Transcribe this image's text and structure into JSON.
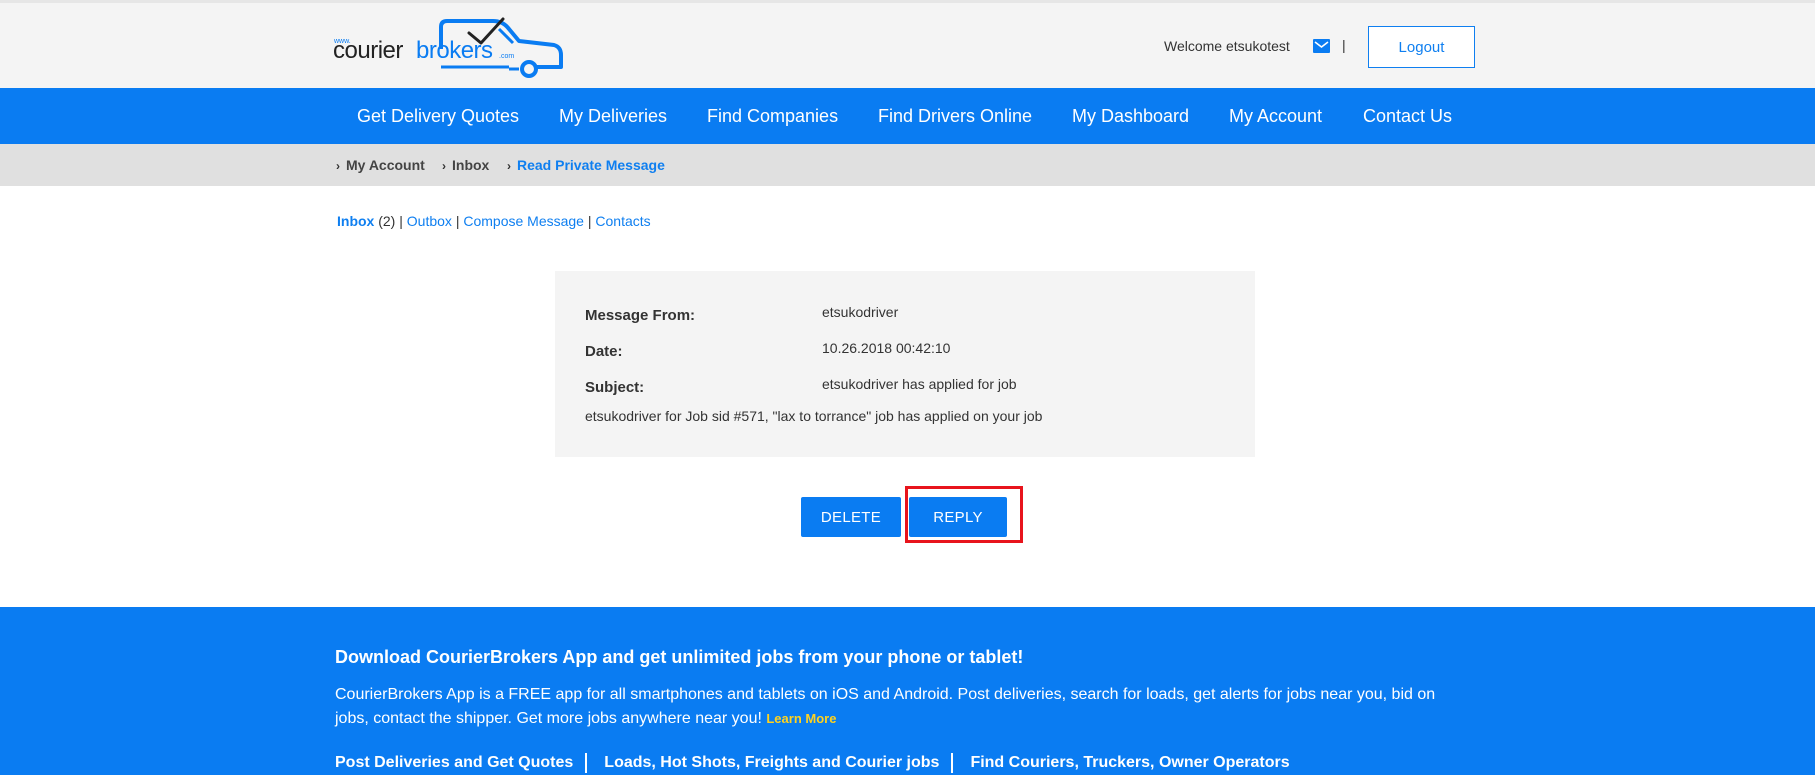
{
  "header": {
    "logo": {
      "www": "www.",
      "courier": "courier",
      "brokers": "brokers",
      "com": ".com"
    },
    "welcome": "Welcome etsukotest",
    "separator": "|",
    "logout_label": "Logout"
  },
  "nav": {
    "items": [
      "Get Delivery Quotes",
      "My Deliveries",
      "Find Companies",
      "Find Drivers Online",
      "My Dashboard",
      "My Account",
      "Contact Us"
    ]
  },
  "breadcrumb": {
    "items": [
      "My Account",
      "Inbox",
      "Read Private Message"
    ]
  },
  "message_links": {
    "inbox": "Inbox",
    "inbox_count": "(2)",
    "separator": "|",
    "outbox": "Outbox",
    "compose": "Compose Message",
    "contacts": "Contacts"
  },
  "message": {
    "from_label": "Message From:",
    "from_value": "etsukodriver",
    "date_label": "Date:",
    "date_value": "10.26.2018 00:42:10",
    "subject_label": "Subject:",
    "subject_value": "etsukodriver has applied for job",
    "body": "etsukodriver for Job sid #571, \"lax to torrance\" job has applied on your job"
  },
  "actions": {
    "delete_label": "DELETE",
    "reply_label": "REPLY"
  },
  "footer": {
    "title": "Download CourierBrokers App and get unlimited jobs from your phone or tablet!",
    "text": "CourierBrokers App is a FREE app for all smartphones and tablets on iOS and Android. Post deliveries, search for loads, get alerts for jobs near you, bid on jobs, contact the shipper. Get more jobs anywhere near you!",
    "learn_more": "Learn More",
    "links": [
      "Post Deliveries and Get Quotes",
      "Loads, Hot Shots, Freights and Courier jobs",
      "Find Couriers, Truckers, Owner Operators"
    ]
  },
  "colors": {
    "brand_blue": "#0a7cf2",
    "link_blue": "#0f7ff0",
    "highlight_red": "#e8141c",
    "learn_more_yellow": "#ffd21f"
  },
  "icons": {
    "mail": "mail-icon",
    "breadcrumb_separator": "chevron-right-icon"
  }
}
